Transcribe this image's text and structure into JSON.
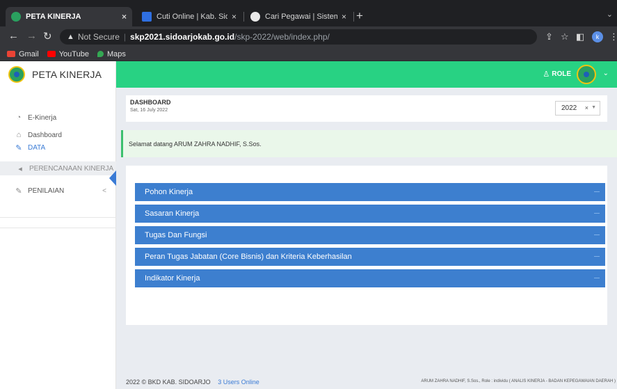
{
  "browser": {
    "tabs": [
      {
        "title": "PETA KINERJA",
        "active": true,
        "favicon_color": "#2aa05f"
      },
      {
        "title": "Cuti Online | Kab. Sidoarjo",
        "active": false,
        "favicon_color": "#2f6fe0"
      },
      {
        "title": "Cari Pegawai | Sistem Informas",
        "active": false,
        "favicon_color": "#e8e8e8"
      }
    ],
    "tab_close": "×",
    "new_tab": "+",
    "address": {
      "security": "Not Secure",
      "host": "skp2021.sidoarjokab.go.id",
      "path": "/skp-2022/web/index.php/"
    },
    "bookmarks": [
      {
        "label": "Gmail",
        "color": "#ea4335"
      },
      {
        "label": "YouTube",
        "color": "#ff0000"
      },
      {
        "label": "Maps",
        "color": "#34a853"
      }
    ],
    "profile_initial": "k"
  },
  "app": {
    "brand": "PETA KINERJA",
    "role_label": "ROLE",
    "accent_green": "#28d283",
    "accent_blue": "#3d7fcf"
  },
  "sidebar": {
    "items": [
      {
        "label": "E-Kinerja",
        "icon": "gauge-icon"
      },
      {
        "label": "Dashboard",
        "icon": "home-icon"
      },
      {
        "label": "DATA",
        "icon": "wrench-icon",
        "active": true
      },
      {
        "label": "PERENCANAAN KINERJA",
        "icon": "megaphone-icon"
      },
      {
        "label": "PENILAIAN",
        "icon": "wrench-icon",
        "arrow": "<"
      }
    ]
  },
  "dashboard": {
    "title": "DASHBOARD",
    "date": "Sat, 16 July 2022",
    "year": "2022",
    "year_clear": "×",
    "welcome": "Selamat datang ARUM ZAHRA NADHIF, S.Sos."
  },
  "accordion": [
    "Pohon Kinerja",
    "Sasaran Kinerja",
    "Tugas Dan Fungsi",
    "Peran Tugas Jabatan (Core Bisnis) dan Kriteria Keberhasilan",
    "Indikator Kinerja"
  ],
  "footer": {
    "copyright": "2022 © BKD KAB. SIDOARJO",
    "online": "3 Users Online",
    "user_info": "ARUM ZAHRA NADHIF, S.Sos., Role : individu ( ANALIS KINERJA - BADAN KEPEGAWAIAN DAERAH )"
  }
}
